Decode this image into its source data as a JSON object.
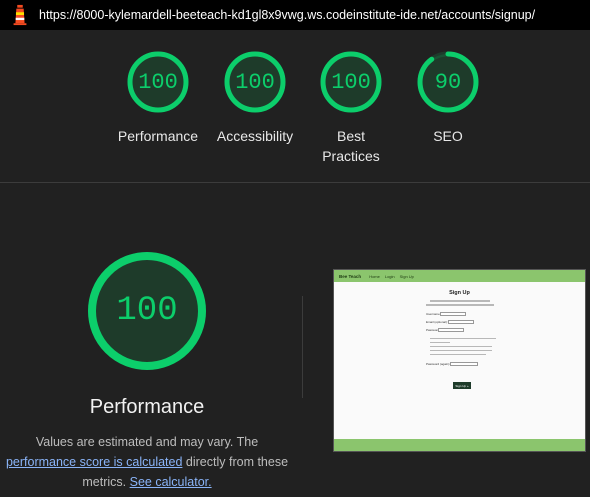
{
  "url": "https://8000-kylemardell-beeteach-kd1gl8x9vwg.ws.codeinstitute-ide.net/accounts/signup/",
  "colors": {
    "pass": "#0cce6b",
    "pass_bg": "#1e3b2a",
    "link": "#8ab4f8"
  },
  "gauges": [
    {
      "label": "Performance",
      "score": "100",
      "value": 100
    },
    {
      "label": "Accessibility",
      "score": "100",
      "value": 100
    },
    {
      "label": "Best Practices",
      "score": "100",
      "value": 100
    },
    {
      "label": "SEO",
      "score": "90",
      "value": 90
    }
  ],
  "main": {
    "score": "100",
    "value": 100,
    "title": "Performance",
    "desc_before": "Values are estimated and may vary. The ",
    "desc_link1": "performance score is calculated",
    "desc_middle": " directly from these metrics. ",
    "desc_link2": "See calculator."
  },
  "thumbnail": {
    "brand": "Bee Teach",
    "nav_items": [
      "Home",
      "Login",
      "Sign Up"
    ],
    "heading": "Sign Up",
    "button": "Sign Up »",
    "fields": [
      "Username:",
      "Email (optional):",
      "Password:",
      "Password (again):"
    ]
  }
}
